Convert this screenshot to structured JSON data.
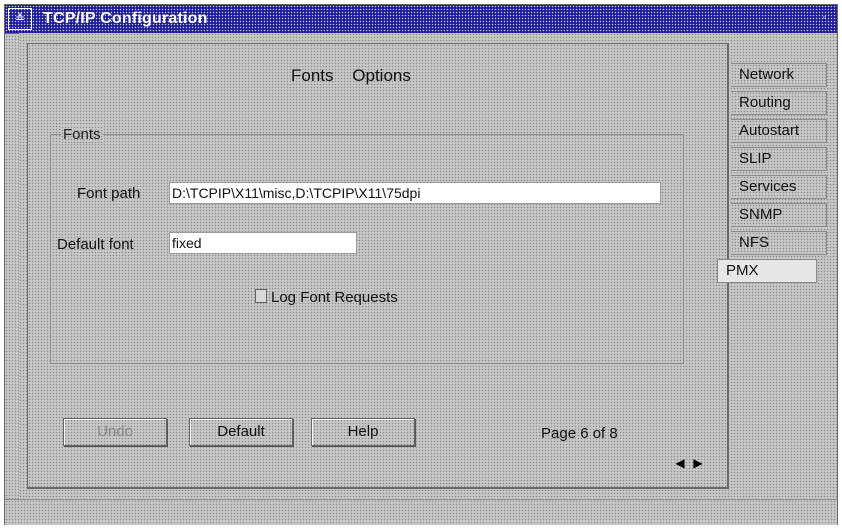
{
  "window": {
    "title": "TCP/IP Configuration",
    "sysmenu_glyph": "≚",
    "minmax_glyph": "▫"
  },
  "menubar": {
    "items": [
      "Fonts",
      "Options"
    ]
  },
  "fonts_group": {
    "label": "Fonts",
    "font_path_label": "Font path",
    "font_path_value": "D:\\TCPIP\\X11\\misc,D:\\TCPIP\\X11\\75dpi",
    "default_font_label": "Default font",
    "default_font_value": "fixed",
    "log_requests_label": "Log Font Requests",
    "log_requests_checked": false
  },
  "buttons": {
    "undo": "Undo",
    "default": "Default",
    "help": "Help"
  },
  "page_indicator": "Page 6 of 8",
  "tabs": [
    {
      "label": "Network",
      "active": false
    },
    {
      "label": "Routing",
      "active": false
    },
    {
      "label": "Autostart",
      "active": false
    },
    {
      "label": "SLIP",
      "active": false
    },
    {
      "label": "Services",
      "active": false
    },
    {
      "label": "SNMP",
      "active": false
    },
    {
      "label": "NFS",
      "active": false
    },
    {
      "label": "PMX",
      "active": true
    }
  ],
  "icons": {
    "prev": "arrow-left-icon",
    "next": "arrow-right-icon"
  },
  "colors": {
    "title_bar": "#1a1aa0",
    "dither": "#c8c8c8"
  }
}
